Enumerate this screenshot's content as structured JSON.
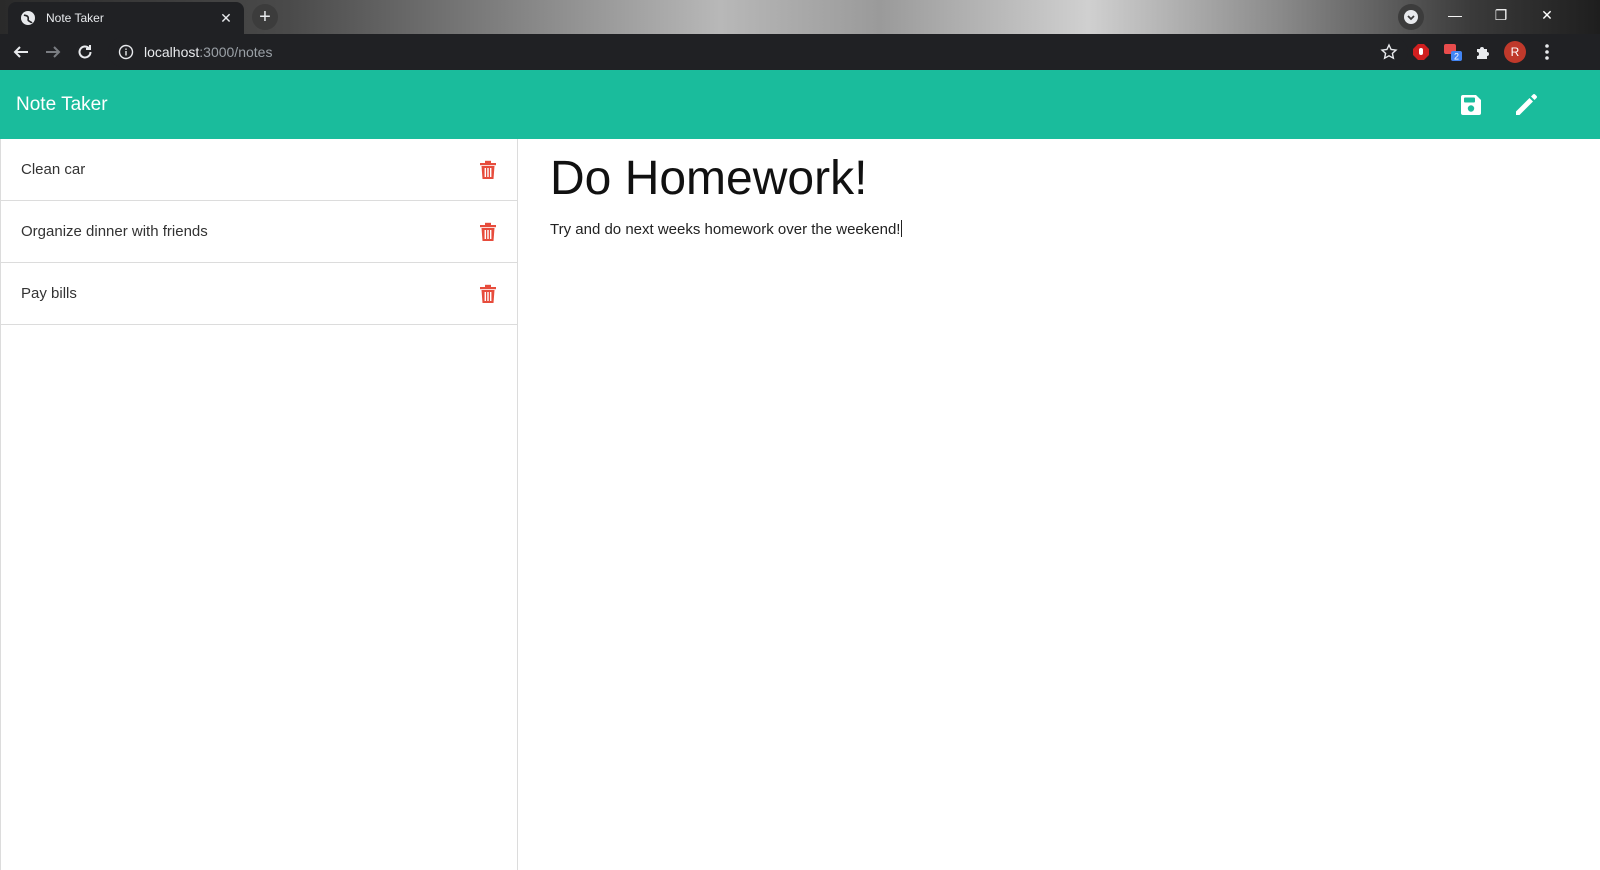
{
  "browser": {
    "tab_title": "Note Taker",
    "url_host": "localhost",
    "url_path": ":3000/notes",
    "profile_initial": "R",
    "extension_badge": "2"
  },
  "app": {
    "brand": "Note Taker",
    "accent_color": "#1abc9c",
    "delete_color": "#e74c3c",
    "actions": {
      "save_icon": "save-icon",
      "new_icon": "pencil-icon"
    }
  },
  "notes": [
    {
      "title": "Clean car"
    },
    {
      "title": "Organize dinner with friends"
    },
    {
      "title": "Pay bills"
    }
  ],
  "active_note": {
    "title": "Do Homework!",
    "text": "Try and do next weeks homework over the weekend!"
  }
}
